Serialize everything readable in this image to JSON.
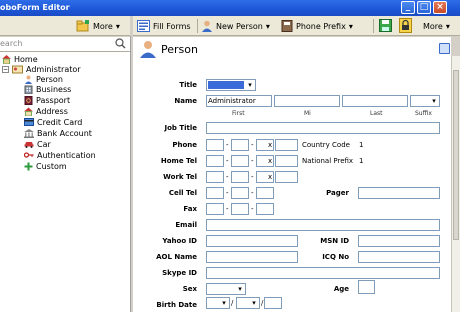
{
  "window": {
    "title": "oboForm Editor"
  },
  "left_toolbar": {
    "more_label": "More"
  },
  "right_toolbar": {
    "fill_forms": "Fill Forms",
    "new_person": "New Person",
    "phone_prefix": "Phone Prefix",
    "more_label": "More"
  },
  "search": {
    "placeholder": "earch"
  },
  "tree": {
    "home": "Home",
    "administrator": "Administrator",
    "items": [
      "Person",
      "Business",
      "Passport",
      "Address",
      "Credit Card",
      "Bank Account",
      "Car",
      "Authentication",
      "Custom"
    ]
  },
  "page": {
    "title": "Person"
  },
  "form": {
    "title": "Title",
    "name": "Name",
    "name_value": "Administrator",
    "first": "First",
    "mi": "Mi",
    "last": "Last",
    "suffix": "Suffix",
    "job_title": "Job Title",
    "phone": "Phone",
    "home_tel": "Home Tel",
    "work_tel": "Work Tel",
    "cell_tel": "Cell Tel",
    "fax": "Fax",
    "country_code": "Country Code",
    "country_code_value": "1",
    "national_prefix": "National Prefix",
    "national_prefix_value": "1",
    "pager": "Pager",
    "email": "Email",
    "yahoo_id": "Yahoo ID",
    "msn_id": "MSN ID",
    "aol_name": "AOL Name",
    "icq_no": "ICQ No",
    "skype_id": "Skype ID",
    "sex": "Sex",
    "age": "Age",
    "birth_date": "Birth Date",
    "x": "x",
    "dash": "-",
    "slash": "/"
  },
  "colors": {
    "titlebar": "#1d56d6",
    "toolbar": "#ece9d8",
    "field_border": "#7f9db9"
  }
}
